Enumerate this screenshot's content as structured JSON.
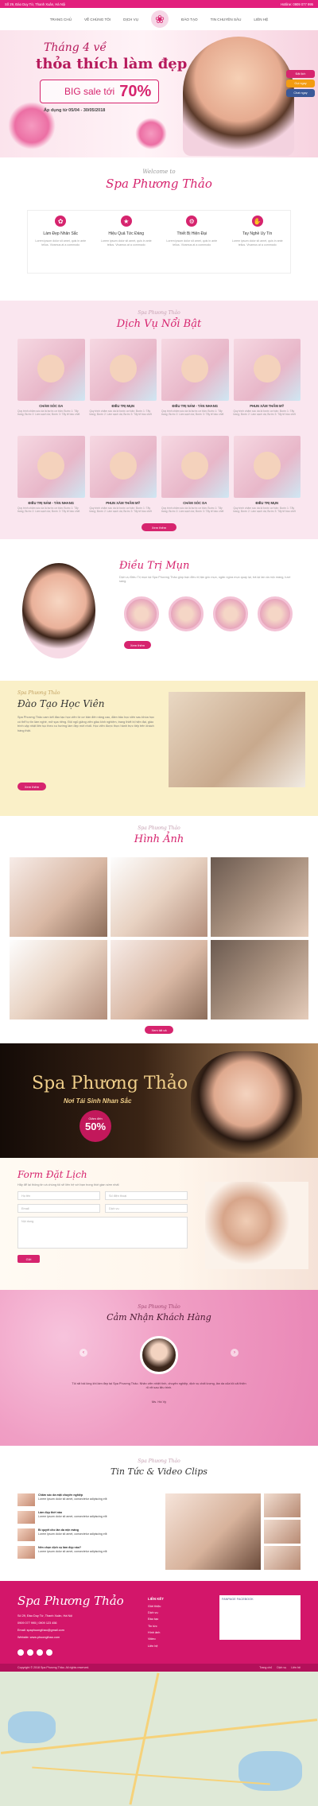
{
  "topbar": {
    "address": "Số 29, Đào Duy Từ, Thanh Xuân, Hà Nội",
    "hotline": "Hotline: 0909 077 995",
    "email": "0909 077 995"
  },
  "nav": {
    "items": [
      "TRANG CHỦ",
      "VỀ CHÚNG TÔI",
      "DỊCH VỤ",
      "ĐÀO TẠO",
      "TIN CHUYÊN SÂU",
      "LIÊN HỆ"
    ]
  },
  "hero": {
    "line1": "Tháng 4 về",
    "line2": "thỏa thích làm đẹp",
    "sale_label": "BIG sale tới",
    "sale_value": "70%",
    "dates": "Áp dụng từ 05/04 - 30/05/2018",
    "side_buttons": [
      "Đặt lịch",
      "Gọi ngay",
      "Chat ngay"
    ]
  },
  "welcome": {
    "kicker": "Welcome to",
    "title": "Spa Phương Thảo",
    "features": [
      {
        "title": "Làm Đẹp Nhân Sắc",
        "desc": "Lorem ipsum dolor sit amet, quis in ante tellus. Vivamus at a commodo"
      },
      {
        "title": "Hiệu Quả Tức Đáng",
        "desc": "Lorem ipsum dolor sit amet, quis in ante tellus. Vivamus at a commodo"
      },
      {
        "title": "Thiết Bị Hiện Đại",
        "desc": "Lorem ipsum dolor sit amet, quis in ante tellus. Vivamus at a commodo"
      },
      {
        "title": "Tay Nghề Uy Tín",
        "desc": "Lorem ipsum dolor sit amet, quis in ante tellus. Vivamus at a commodo"
      }
    ]
  },
  "services": {
    "kicker": "Spa Phương Thảo",
    "title": "Dịch Vụ Nổi Bật",
    "items": [
      {
        "name": "CHĂM SÓC DA",
        "desc": "Quy trình chăm sóc da là bước cơ bản: Bước 1: Tẩy trang; Bước 2: Làm sạch da; Bước 3: Tẩy tế bào chết"
      },
      {
        "name": "ĐIỀU TRỊ MỤN",
        "desc": "Quy trình chăm sóc da là bước cơ bản: Bước 1: Tẩy trang; Bước 2: Làm sạch da; Bước 3: Tẩy tế bào chết"
      },
      {
        "name": "ĐIỀU TRỊ NÁM - TÀN NHANG",
        "desc": "Quy trình chăm sóc da là bước cơ bản: Bước 1: Tẩy trang; Bước 2: Làm sạch da; Bước 3: Tẩy tế bào chết"
      },
      {
        "name": "PHUN XĂM THẨM MỸ",
        "desc": "Quy trình chăm sóc da là bước cơ bản: Bước 1: Tẩy trang; Bước 2: Làm sạch da; Bước 3: Tẩy tế bào chết"
      },
      {
        "name": "ĐIỀU TRỊ NÁM - TÀN NHANG",
        "desc": "Quy trình chăm sóc da là bước cơ bản: Bước 1: Tẩy trang; Bước 2: Làm sạch da; Bước 3: Tẩy tế bào chết"
      },
      {
        "name": "PHUN XĂM THẨM MỸ",
        "desc": "Quy trình chăm sóc da là bước cơ bản: Bước 1: Tẩy trang; Bước 2: Làm sạch da; Bước 3: Tẩy tế bào chết"
      },
      {
        "name": "CHĂM SÓC DA",
        "desc": "Quy trình chăm sóc da là bước cơ bản: Bước 1: Tẩy trang; Bước 2: Làm sạch da; Bước 3: Tẩy tế bào chết"
      },
      {
        "name": "ĐIỀU TRỊ MỤN",
        "desc": "Quy trình chăm sóc da là bước cơ bản: Bước 1: Tẩy trang; Bước 2: Làm sạch da; Bước 3: Tẩy tế bào chết"
      }
    ],
    "button": "Xem thêm"
  },
  "treatment": {
    "title": "Điều Trị Mụn",
    "desc": "Dịch vụ Điều Trị mụn tại Spa Phương Thảo giúp bạn điều trị tận gốc mụn, ngăn ngừa mụn quay lại, trả lại làn da mịn màng, tươi sáng.",
    "button": "Xem thêm"
  },
  "training": {
    "kicker": "Spa Phương Thảo",
    "title": "Đào Tạo Học Viên",
    "desc": "Spa Phương Thảo cam kết đào tạo học viên từ cơ bản đến nâng cao, đảm bảo học viên sau khóa học có thể tự tin làm nghề, mở spa riêng. Đội ngũ giảng viên giàu kinh nghiệm, trang thiết bị hiện đại, giáo trình cập nhật liên tục theo xu hướng làm đẹp mới nhất. Học viên được thực hành trực tiếp trên khách hàng thật.",
    "button": "Xem thêm"
  },
  "gallery": {
    "kicker": "Spa Phương Thảo",
    "title": "Hình Ảnh",
    "button": "Xem tất cả"
  },
  "promo": {
    "title": "Spa Phương Thảo",
    "subtitle": "Nơi Tái Sinh Nhan Sắc",
    "badge_label": "Giảm đến",
    "badge_value": "50%"
  },
  "booking": {
    "title": "Form Đặt Lịch",
    "desc": "Hãy để lại thông tin và chúng tôi sẽ liên hệ với bạn trong thời gian sớm nhất",
    "fields": {
      "name": "Họ tên",
      "phone": "Số điện thoại",
      "email": "Email",
      "service": "Dịch vụ",
      "message": "Nội dung"
    },
    "submit": "Gửi"
  },
  "testimonials": {
    "kicker": "Spa Phương Thảo",
    "title": "Cảm Nhận Khách Hàng",
    "quote": "Tôi rất hài lòng khi làm đẹp tại Spa Phương Thảo. Nhân viên nhiệt tình, chuyên nghiệp, dịch vụ chất lượng, làn da của tôi cải thiện rõ rệt sau liệu trình.",
    "name": "Ms. Hà Vy"
  },
  "news": {
    "kicker": "Spa Phương Thảo",
    "title": "Tin Tức & Video Clips",
    "items": [
      {
        "title": "Chăm sóc da mặt chuyên nghiệp",
        "desc": "Lorem ipsum dolor sit amet, consectetur adipiscing elit"
      },
      {
        "title": "Làm đẹp thời nào",
        "desc": "Lorem ipsum dolor sit amet, consectetur adipiscing elit"
      },
      {
        "title": "Bí quyết cho làn da mịn màng",
        "desc": "Lorem ipsum dolor sit amet, consectetur adipiscing elit"
      },
      {
        "title": "Nên chọn dịch vụ làm đẹp nào?",
        "desc": "Lorem ipsum dolor sit amet, consectetur adipiscing elit"
      }
    ]
  },
  "footer": {
    "logo": "Spa Phương Thảo",
    "address": "Số 29, Đào Duy Từ, Thanh Xuân, Hà Nội",
    "phone": "0909 077 995 | 0909 123 456",
    "email": "Email: spaphuongthao@gmail.com",
    "website": "Website: www.phuongthao.com",
    "links_title": "LIÊN KẾT",
    "links": [
      "Giới thiệu",
      "Dịch vụ",
      "Đào tạo",
      "Tin tức",
      "Hình ảnh",
      "Video",
      "Liên hệ"
    ],
    "fb_label": "FANPAGE FACEBOOK",
    "copyright": "Copyright © 2018 Spa Phương Thảo. All rights reserved.",
    "bottom_links": [
      "Trang chủ",
      "Dịch vụ",
      "Liên hệ"
    ]
  },
  "colors": {
    "brand": "#d6246e",
    "topbar": "#e21f7d",
    "footer": "#d3166a"
  }
}
